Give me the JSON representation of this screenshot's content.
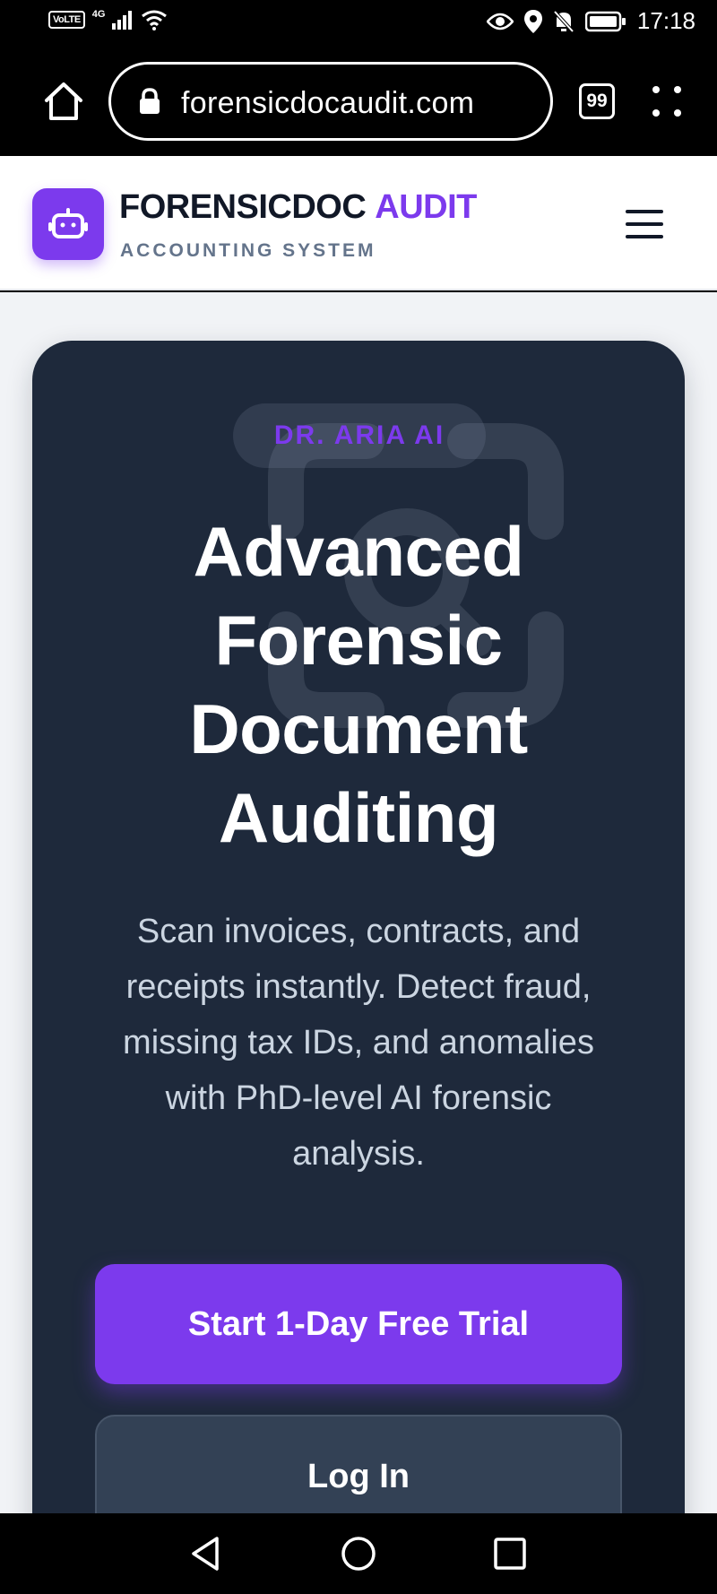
{
  "status_bar": {
    "time": "17:18",
    "volte": "VoLTE",
    "network": "4G"
  },
  "browser": {
    "url": "forensicdocaudit.com",
    "tab_count": "99"
  },
  "header": {
    "brand_main": "FORENSICDOC",
    "brand_accent": "AUDIT",
    "brand_sub": "ACCOUNTING SYSTEM"
  },
  "hero": {
    "badge": "DR. ARIA AI",
    "title_lines": [
      "Advanced",
      "Forensic",
      "Document",
      "Auditing"
    ],
    "description": "Scan invoices, contracts, and receipts instantly. Detect fraud, missing tax IDs, and anomalies with PhD-level AI forensic analysis.",
    "primary_cta": "Start 1-Day Free Trial",
    "secondary_cta": "Log In"
  },
  "colors": {
    "accent": "#7c3aed",
    "hero_bg": "#1e293b",
    "page_bg": "#f1f3f6"
  }
}
